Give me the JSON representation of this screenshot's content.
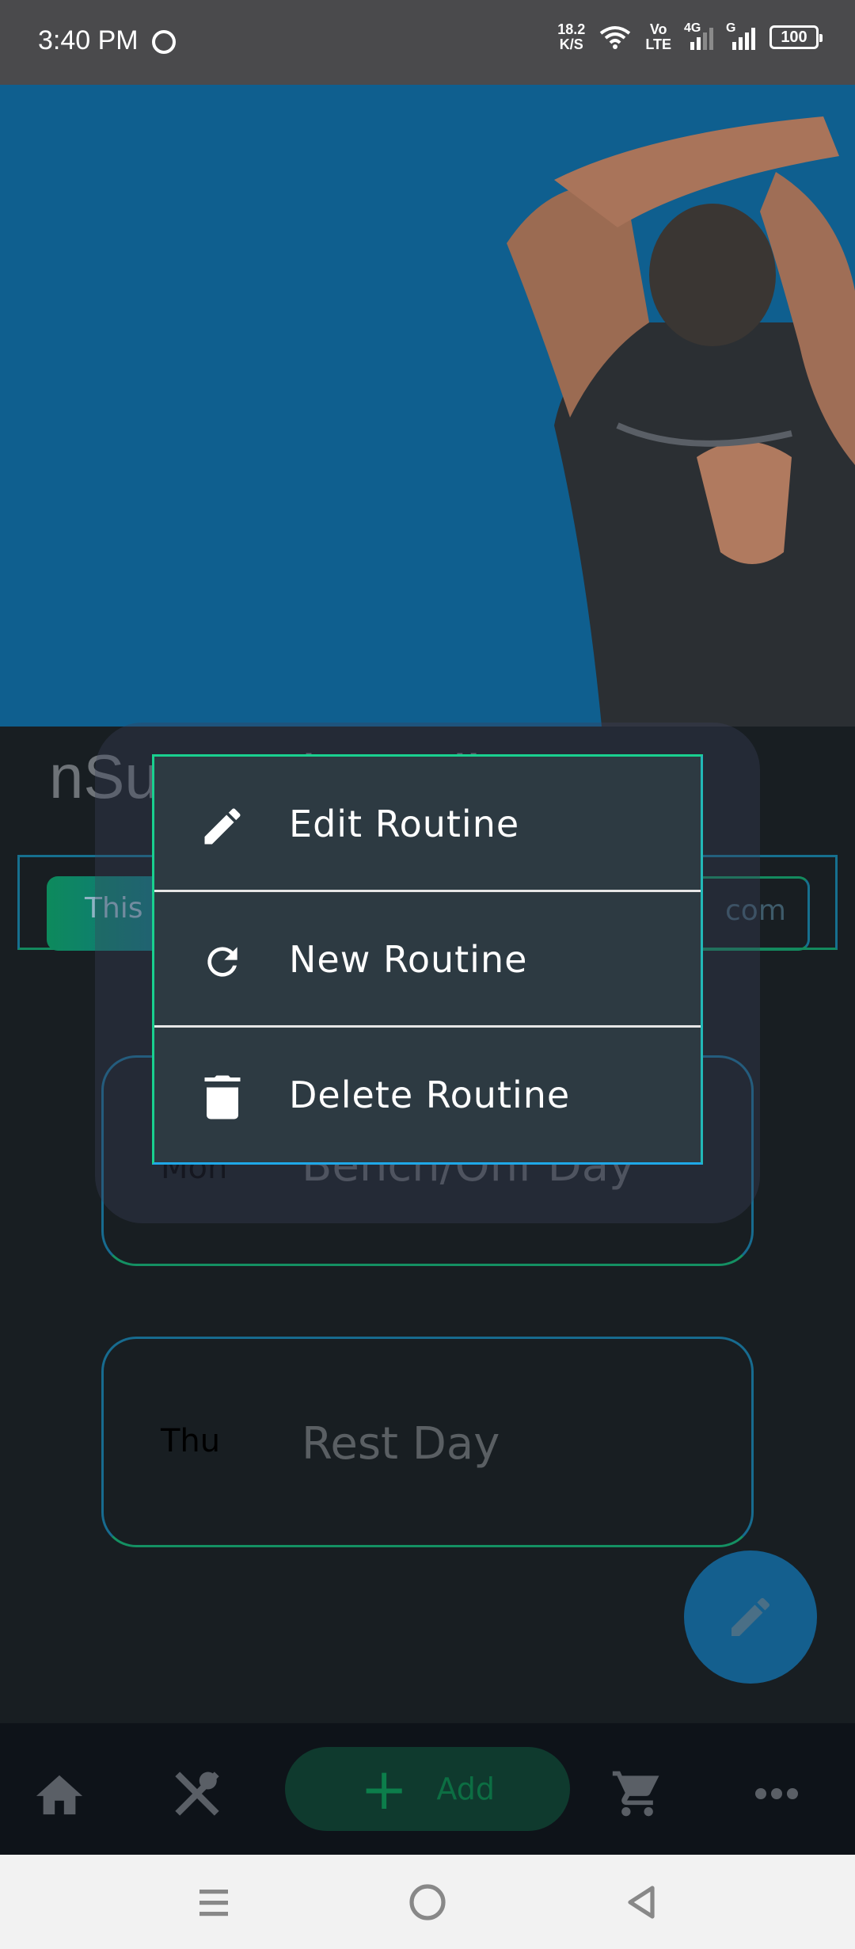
{
  "status_bar": {
    "time": "3:40 PM",
    "net_speed_value": "18.2",
    "net_speed_unit": "K/S",
    "volte_top": "Vo",
    "volte_bottom": "LTE",
    "sim1_label": "4G",
    "sim2_label": "G",
    "battery": "100"
  },
  "main": {
    "gym_title": "nSu    t P  t   i  Cardio",
    "week_left": "This W",
    "week_right": "com",
    "days": [
      {
        "abbr": "Mon",
        "name": "Bench/Ohf  Day"
      },
      {
        "abbr": "Thu",
        "name": "Rest Day"
      }
    ]
  },
  "context_menu": {
    "items": [
      {
        "label": "Edit Routine",
        "icon": "pencil-icon"
      },
      {
        "label": "New Routine",
        "icon": "refresh-icon"
      },
      {
        "label": "Delete Routine",
        "icon": "trash-icon"
      }
    ]
  },
  "bottom_nav": {
    "add_label": "Add",
    "items": [
      "home-icon",
      "food-icon",
      "cart-icon",
      "more-icon"
    ]
  },
  "colors": {
    "hero": "#0f5f8f",
    "menu_bg": "#2d3a42",
    "accent_green": "#19d08f",
    "accent_blue": "#1fa8e8"
  }
}
